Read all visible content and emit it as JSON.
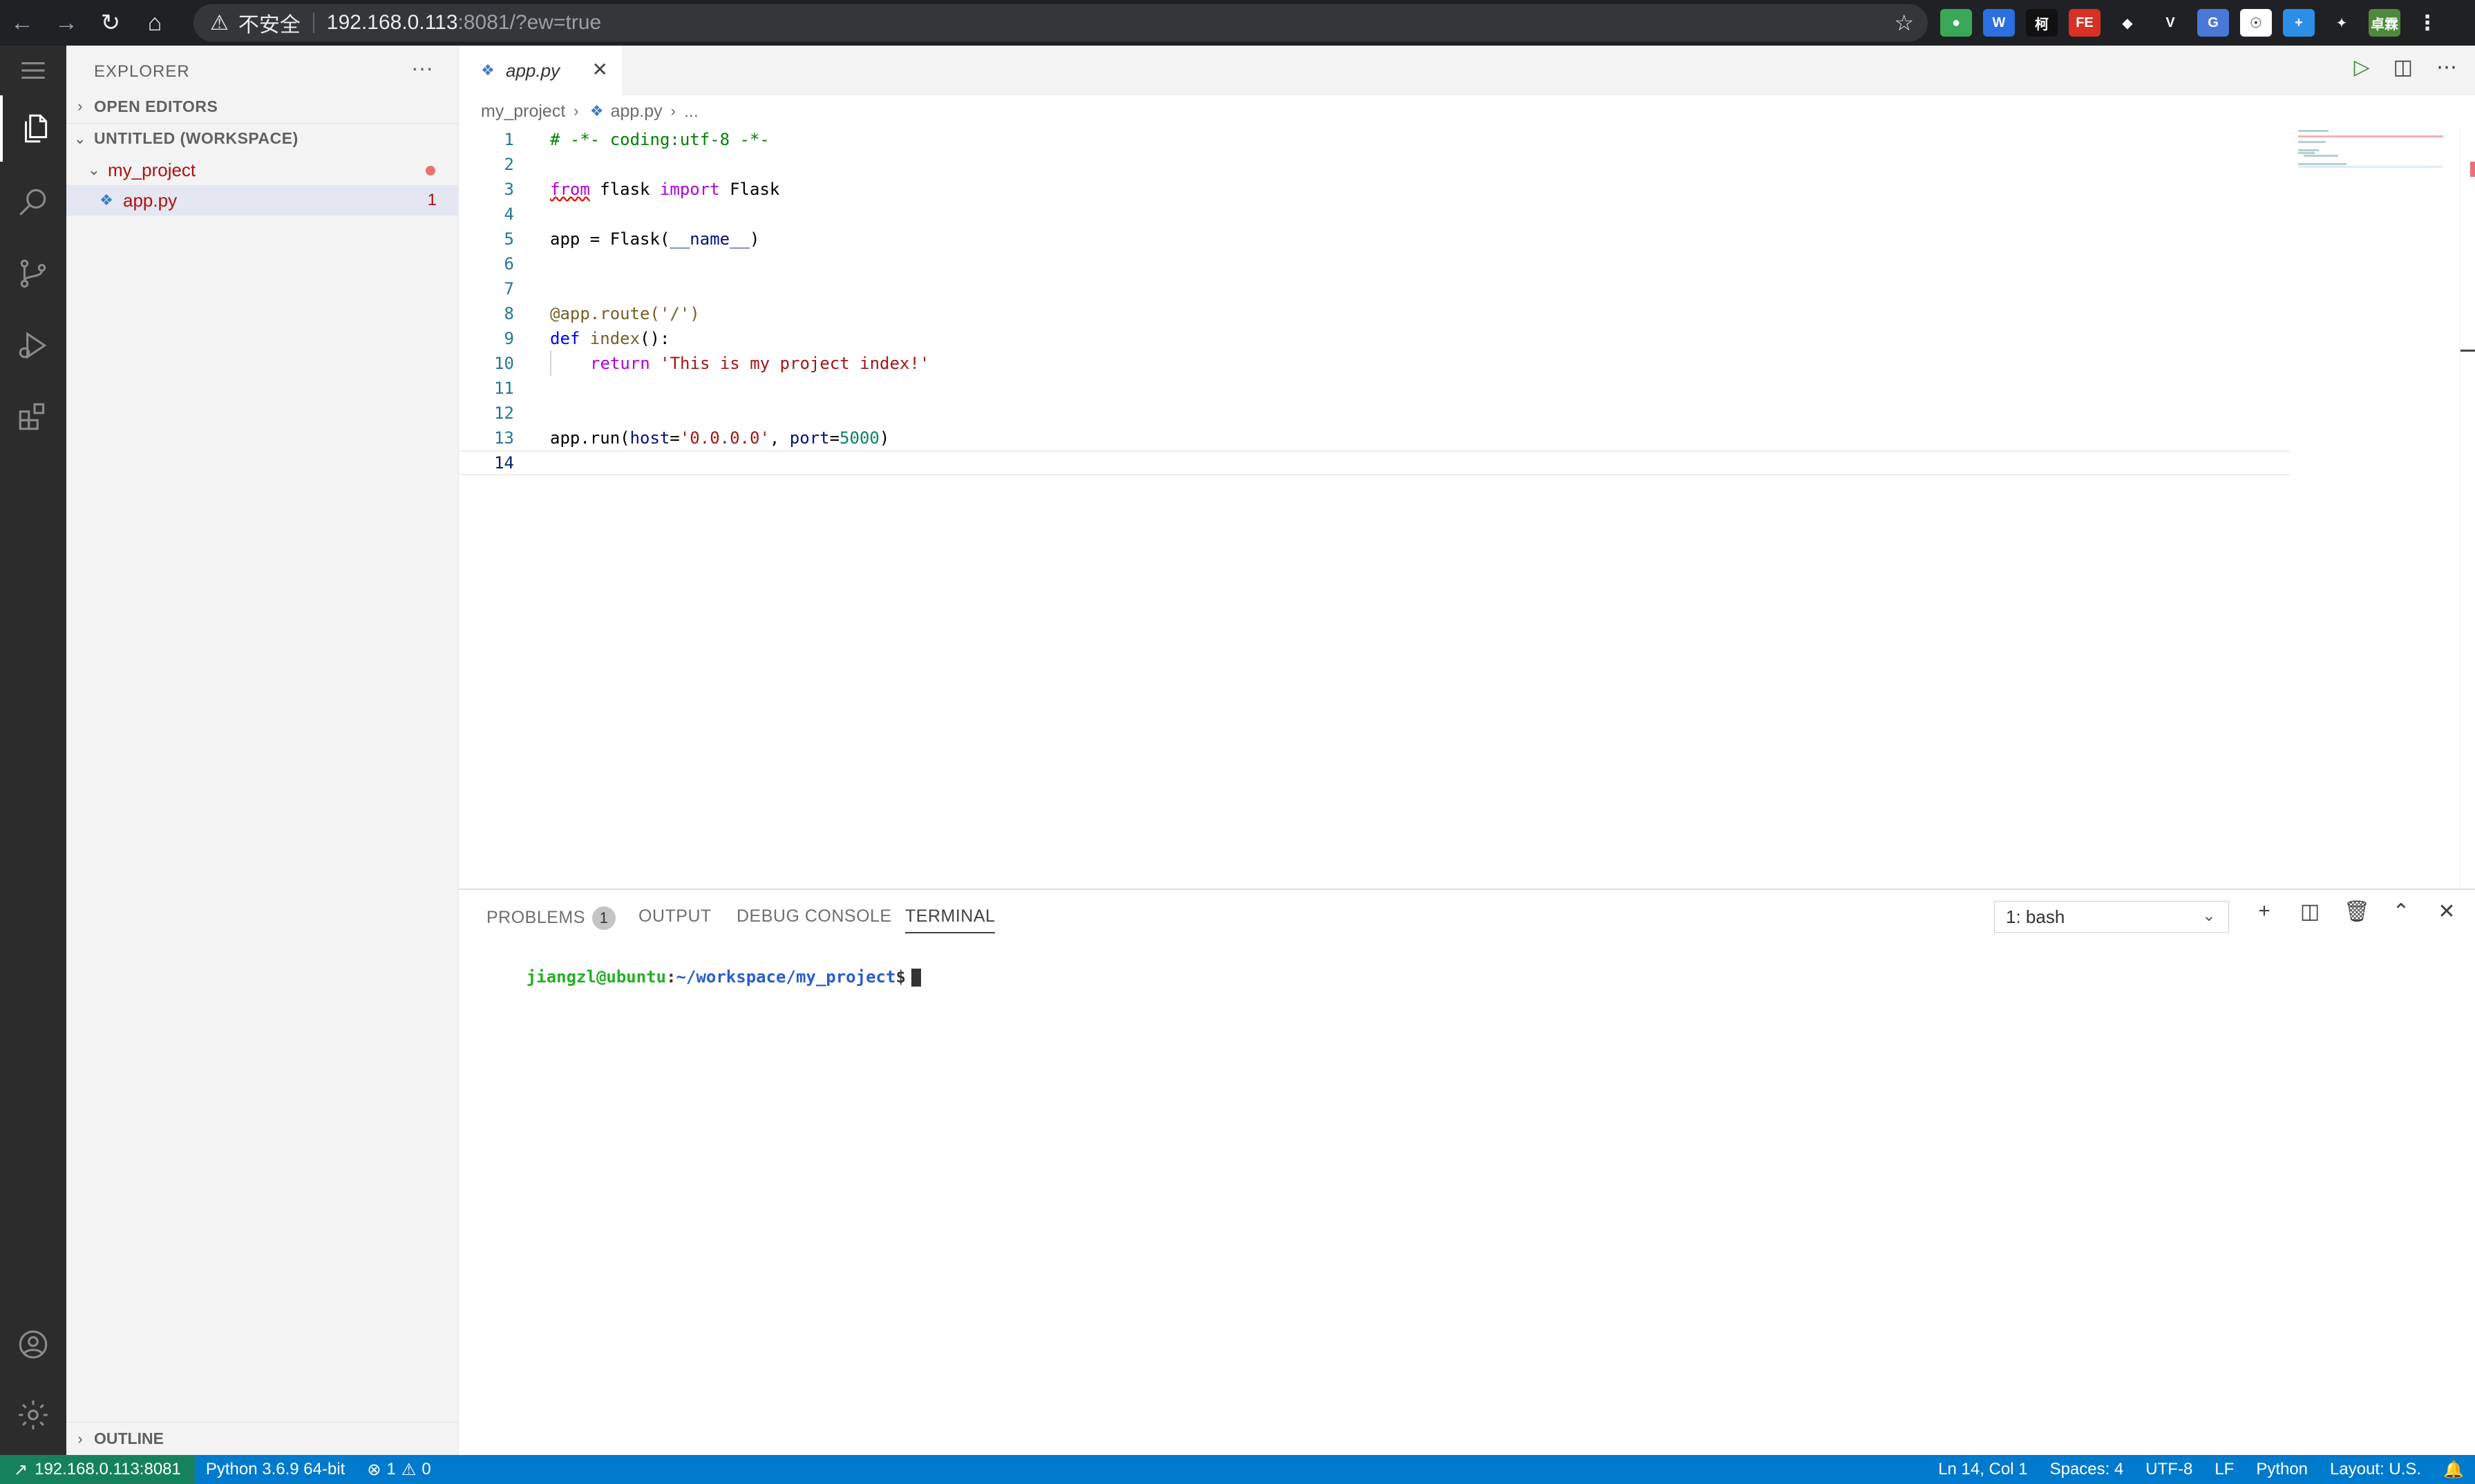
{
  "browser": {
    "security_label": "不安全",
    "url_host": "192.168.0.113",
    "url_rest": ":8081/?ew=true",
    "ext_colors": [
      "#3aa757",
      "#2b6fe0",
      "#111111",
      "#d93025",
      "#202124",
      "#202124",
      "#4a78d8",
      "#ffffff",
      "#2b8fe8",
      "#202124",
      "#4e8a3c"
    ],
    "profile_text": "卓霖"
  },
  "sidebar": {
    "title": "EXPLORER",
    "more": "···",
    "open_editors": "OPEN EDITORS",
    "workspace": "UNTITLED (WORKSPACE)",
    "folder": "my_project",
    "file": "app.py",
    "file_problems": "1",
    "outline": "OUTLINE"
  },
  "editor": {
    "tab_label": "app.py",
    "breadcrumb_folder": "my_project",
    "breadcrumb_file": "app.py",
    "breadcrumb_more": "...",
    "lines": [
      {
        "n": "1"
      },
      {
        "n": "2"
      },
      {
        "n": "3"
      },
      {
        "n": "4"
      },
      {
        "n": "5"
      },
      {
        "n": "6"
      },
      {
        "n": "7"
      },
      {
        "n": "8"
      },
      {
        "n": "9"
      },
      {
        "n": "10"
      },
      {
        "n": "11"
      },
      {
        "n": "12"
      },
      {
        "n": "13"
      },
      {
        "n": "14"
      }
    ],
    "code": {
      "l1": "# -*- coding:utf-8 -*-",
      "l3_from": "from",
      "l3_mod": " flask ",
      "l3_import": "import",
      "l3_name": " Flask",
      "l5_a": "app = Flask(",
      "l5_b": "__name__",
      "l5_c": ")",
      "l8": "@app.route('/')",
      "l9_def": "def",
      "l9_fn": " index",
      "l9_rest": "():",
      "l10_ret": "return",
      "l10_str": " 'This is my project index!'",
      "l13_a": "app.run(",
      "l13_host": "host",
      "l13_eq1": "=",
      "l13_hostval": "'0.0.0.0'",
      "l13_comma": ", ",
      "l13_port": "port",
      "l13_eq2": "=",
      "l13_portval": "5000",
      "l13_close": ")"
    }
  },
  "panel": {
    "tabs": [
      "PROBLEMS",
      "OUTPUT",
      "DEBUG CONSOLE",
      "TERMINAL"
    ],
    "problems_count": "1",
    "terminal_select": "1: bash",
    "prompt_user": "jiangzl@ubuntu",
    "prompt_colon": ":",
    "prompt_path": "~/workspace/my_project",
    "prompt_dollar": "$"
  },
  "statusbar": {
    "remote": "192.168.0.113:8081",
    "python": "Python 3.6.9 64-bit",
    "errors": "1",
    "warnings": "0",
    "position": "Ln 14, Col 1",
    "spaces": "Spaces: 4",
    "encoding": "UTF-8",
    "eol": "LF",
    "language": "Python",
    "layout": "Layout: U.S."
  }
}
